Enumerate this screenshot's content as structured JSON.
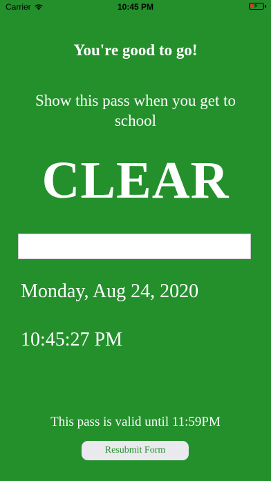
{
  "status_bar": {
    "carrier": "Carrier",
    "time": "10:45 PM",
    "icons": [
      "wifi-icon",
      "battery-icon"
    ]
  },
  "pass": {
    "headline": "You're good to go!",
    "instructions": "Show this pass when you get to school",
    "status": "CLEAR",
    "date": "Monday, Aug 24, 2020",
    "time": "10:45:27 PM",
    "validity": "This pass is valid until 11:59PM",
    "resubmit_label": "Resubmit Form"
  },
  "colors": {
    "background": "#24902c",
    "text": "#ffffff",
    "button_bg": "#e9e9ee",
    "battery_low": "#e0342b"
  }
}
